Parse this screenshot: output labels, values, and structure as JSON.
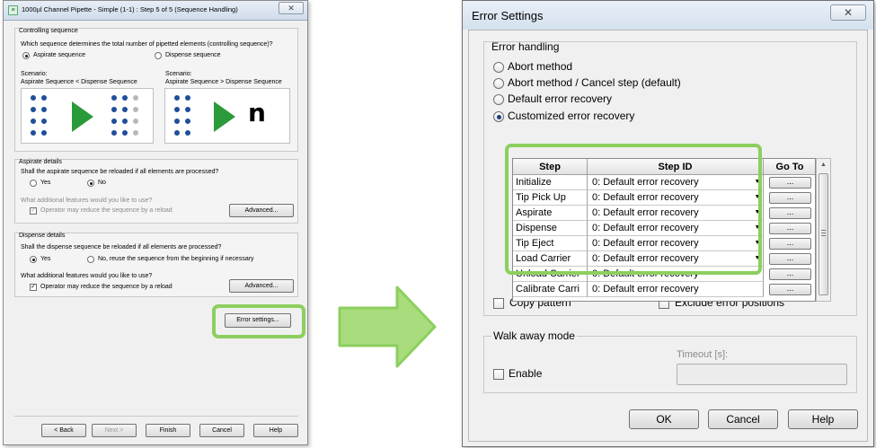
{
  "left": {
    "title": "1000µl Channel Pipette - Simple (1-1) : Step 5 of 5 (Sequence Handling)",
    "close": "✕",
    "controlling": {
      "heading": "Controlling sequence",
      "question": "Which sequence determines the total number of pipetted elements (controlling sequence)?",
      "opt_aspirate": "Aspirate sequence",
      "opt_dispense": "Dispense sequence",
      "scenario_label": "Scenario:",
      "scenario1": "Aspirate Sequence < Dispense Sequence",
      "scenario2": "Aspirate Sequence > Dispense Sequence",
      "n_glyph": "n"
    },
    "aspirate": {
      "heading": "Aspirate details",
      "question": "Shall the aspirate sequence be reloaded if all elements are processed?",
      "yes": "Yes",
      "no": "No",
      "features_q": "What additional features would you like to use?",
      "operator": "Operator may reduce the sequence by a reload",
      "advanced": "Advanced..."
    },
    "dispense": {
      "heading": "Dispense details",
      "question": "Shall the dispense sequence be reloaded if all elements are processed?",
      "yes": "Yes",
      "no_reuse": "No, reuse the sequence from the beginning if necessary",
      "features_q": "What additional features would you like to use?",
      "operator": "Operator may reduce the sequence by a reload",
      "advanced": "Advanced..."
    },
    "error_settings_button": "Error settings...",
    "footer": {
      "back": "< Back",
      "next": "Next >",
      "finish": "Finish",
      "cancel": "Cancel",
      "help": "Help"
    }
  },
  "right": {
    "title": "Error Settings",
    "close": "✕",
    "error_handling": {
      "heading": "Error handling",
      "options": [
        "Abort method",
        "Abort method / Cancel step (default)",
        "Default error recovery",
        "Customized error recovery"
      ],
      "selected_index": 3
    },
    "grid": {
      "columns": [
        "Step",
        "Step ID",
        "Go To"
      ],
      "rows": [
        {
          "step": "Initialize",
          "step_id": "0: Default error recovery",
          "goto": "..."
        },
        {
          "step": "Tip Pick Up",
          "step_id": "0: Default error recovery",
          "goto": "..."
        },
        {
          "step": "Aspirate",
          "step_id": "0: Default error recovery",
          "goto": "..."
        },
        {
          "step": "Dispense",
          "step_id": "0: Default error recovery",
          "goto": "..."
        },
        {
          "step": "Tip Eject",
          "step_id": "0: Default error recovery",
          "goto": "..."
        },
        {
          "step": "Load Carrier",
          "step_id": "0: Default error recovery",
          "goto": "..."
        },
        {
          "step": "Unload Carrier",
          "step_id": "0: Default error recovery",
          "goto": "..."
        },
        {
          "step": "Calibrate Carri",
          "step_id": "0: Default error recovery",
          "goto": "..."
        }
      ]
    },
    "copy_pattern": "Copy pattern",
    "exclude_error_positions": "Exclude error positions",
    "walk_away": {
      "heading": "Walk away mode",
      "enable": "Enable",
      "timeout_label": "Timeout [s]:",
      "timeout_value": ""
    },
    "buttons": {
      "ok": "OK",
      "cancel": "Cancel",
      "help": "Help"
    }
  },
  "colors": {
    "highlight": "#8ccf5e",
    "arrow": "#a9dc7c",
    "arrow_edge": "#8ccf5e",
    "well_blue": "#1f4e9a",
    "play_green": "#2b9a3a"
  }
}
